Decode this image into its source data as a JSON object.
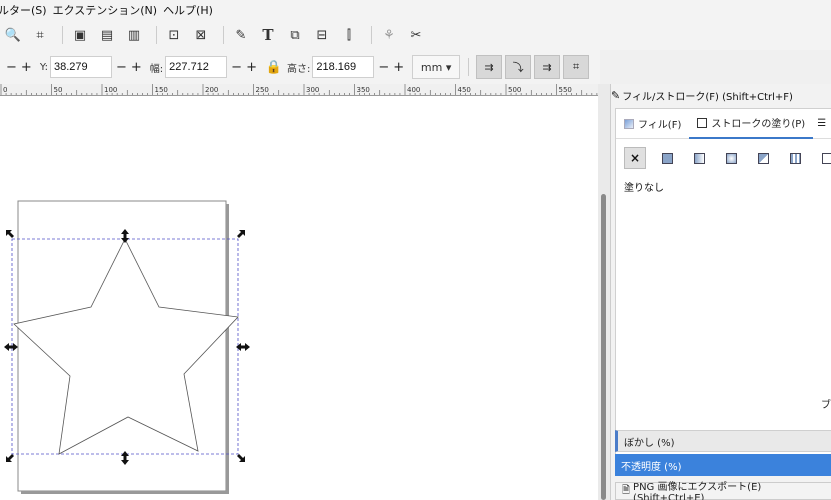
{
  "menubar": {
    "items": [
      "ルター(S)",
      "エクステンション(N)",
      "ヘルプ(H)"
    ]
  },
  "toolbar": {
    "icons": [
      "zoom-drawing-icon",
      "zoom-page-icon",
      "duplicate-icon",
      "clone-icon",
      "unlink-clone-icon",
      "group-icon",
      "ungroup-icon",
      "fill-stroke-icon",
      "text-icon",
      "layers-icon",
      "xml-editor-icon",
      "align-icon",
      "symbols-icon",
      "preferences-icon"
    ]
  },
  "controls": {
    "x_minus": "−",
    "x_plus": "+",
    "y_label": "Y:",
    "y_value": "38.279",
    "w_label": "幅:",
    "w_value": "227.712",
    "lock_icon": "lock-icon",
    "h_label": "高さ:",
    "h_value": "218.169",
    "unit": "mm"
  },
  "ruler": {
    "labels": [
      "0",
      "50",
      "100",
      "150",
      "200",
      "250",
      "300",
      "350",
      "400",
      "450",
      "500",
      "550"
    ]
  },
  "panel": {
    "title": "フィル/ストローク(F) (Shift+Ctrl+F)",
    "tabs": [
      "フィル(F)",
      "ストロークの塗り(P)"
    ],
    "no_paint": "×",
    "help": "?",
    "no_paint_label": "塗りなし",
    "blend_label": "ブ",
    "blur_label": "ぼかし (%)",
    "opacity_label": "不透明度 (%)",
    "export_label": "PNG 画像にエクスポート(E) (Shift+Ctrl+E)"
  },
  "colors": {
    "accent": "#3b82dc",
    "canvas": "#ffffff",
    "selection": "#4040c0"
  }
}
